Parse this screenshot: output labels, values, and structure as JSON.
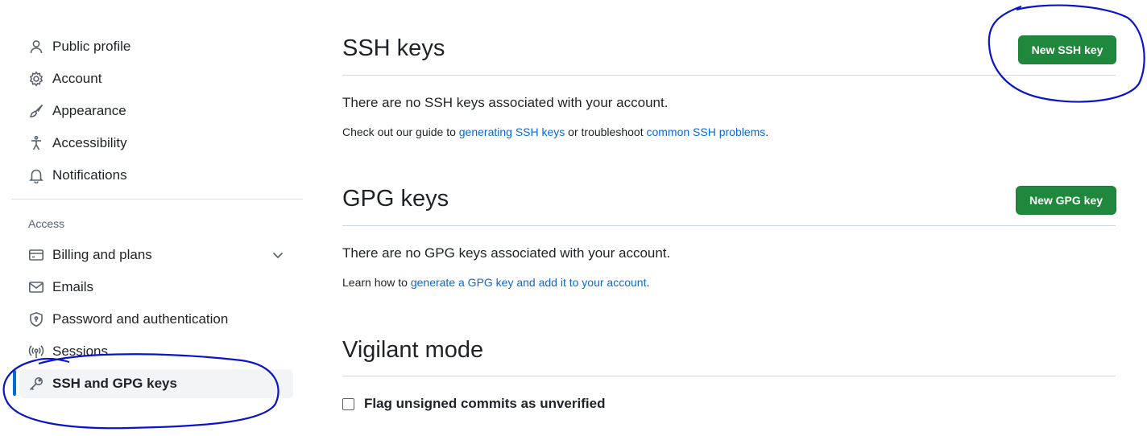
{
  "sidebar": {
    "items_top": [
      {
        "label": "Public profile",
        "icon": "person-icon"
      },
      {
        "label": "Account",
        "icon": "gear-icon"
      },
      {
        "label": "Appearance",
        "icon": "paintbrush-icon"
      },
      {
        "label": "Accessibility",
        "icon": "accessibility-icon"
      },
      {
        "label": "Notifications",
        "icon": "bell-icon"
      }
    ],
    "group_title": "Access",
    "items_access": [
      {
        "label": "Billing and plans",
        "icon": "credit-card-icon"
      },
      {
        "label": "Emails",
        "icon": "mail-icon"
      },
      {
        "label": "Password and authentication",
        "icon": "shield-lock-icon"
      },
      {
        "label": "Sessions",
        "icon": "broadcast-icon"
      },
      {
        "label": "SSH and GPG keys",
        "icon": "key-icon",
        "active": true
      }
    ]
  },
  "ssh": {
    "title": "SSH keys",
    "button": "New SSH key",
    "empty": "There are no SSH keys associated with your account.",
    "note_prefix": "Check out our guide to ",
    "link1": "generating SSH keys",
    "note_middle": " or troubleshoot ",
    "link2": "common SSH problems",
    "note_suffix": "."
  },
  "gpg": {
    "title": "GPG keys",
    "button": "New GPG key",
    "empty": "There are no GPG keys associated with your account.",
    "note_prefix": "Learn how to ",
    "link": "generate a GPG key and add it to your account",
    "note_suffix": "."
  },
  "vigilant": {
    "title": "Vigilant mode",
    "checkbox_label": "Flag unsigned commits as unverified"
  },
  "colors": {
    "accent": "#0969da",
    "primary_button": "#1f883d",
    "annotation": "#0a14c8"
  }
}
